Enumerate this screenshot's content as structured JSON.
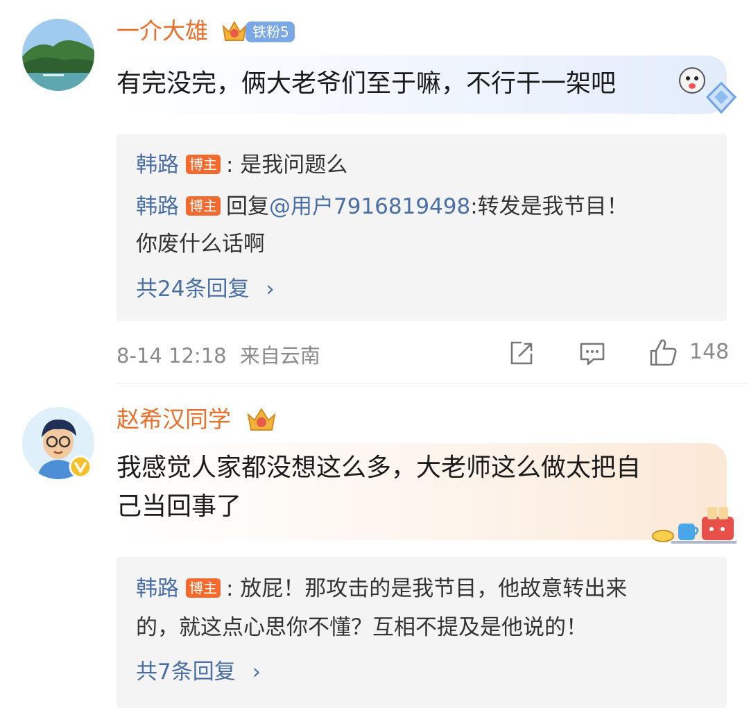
{
  "comments": [
    {
      "user": "一介大雄",
      "fan_badge": "铁粉5",
      "text": "有完没完，俩大老爷们至于嘛，不行干一架吧",
      "replies": [
        {
          "name": "韩路",
          "tag": "博主",
          "content": ": 是我问题么"
        },
        {
          "name": "韩路",
          "tag": "博主",
          "content_prefix": "回复",
          "mention": "@用户7916819498",
          "content": ":转发是我节目！",
          "content_line2": "你废什么话啊"
        }
      ],
      "more": "共24条回复",
      "chevron": "›",
      "time": "8-14 12:18",
      "location": "来自云南",
      "likes": "148"
    },
    {
      "user": "赵希汉同学",
      "text_line1": "我感觉人家都没想这么多，大老师这么做太把自",
      "text_line2": "己当回事了",
      "replies": [
        {
          "name": "韩路",
          "tag": "博主",
          "content": ": 放屁！那攻击的是我节目，他故意转出来",
          "content_line2": "的，就这点心思你不懂？互相不提及是他说的！"
        }
      ],
      "more": "共7条回复",
      "chevron": "›"
    }
  ],
  "colors": {
    "username": "#e8702a",
    "link": "#4a6fa5",
    "tag": "#f26a2e",
    "meta": "#8a8a8a"
  },
  "icons": [
    "crown-badge-icon",
    "share-icon",
    "comment-icon",
    "like-icon",
    "verified-icon",
    "sticker-icon"
  ]
}
